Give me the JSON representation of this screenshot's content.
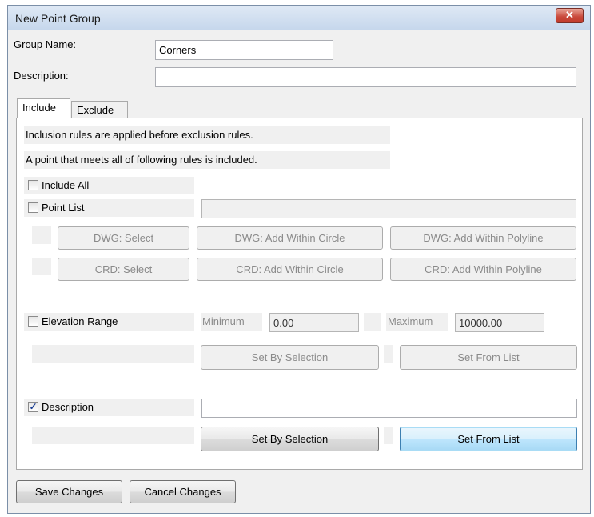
{
  "window": {
    "title": "New Point Group",
    "close_glyph": "✕"
  },
  "form": {
    "group_name_label": "Group Name:",
    "group_name_value": "Corners",
    "description_label": "Description:",
    "description_value": ""
  },
  "tabs": [
    {
      "label": "Include",
      "active": true
    },
    {
      "label": "Exclude",
      "active": false
    }
  ],
  "include": {
    "info_line_1": "Inclusion rules are applied before exclusion rules.",
    "info_line_2": "A point that meets all of following rules is included.",
    "include_all": {
      "label": "Include All",
      "checked": false
    },
    "point_list": {
      "label": "Point List",
      "checked": false,
      "value": ""
    },
    "dwg_buttons": [
      "DWG: Select",
      "DWG: Add Within Circle",
      "DWG: Add Within Polyline"
    ],
    "crd_buttons": [
      "CRD: Select",
      "CRD: Add Within Circle",
      "CRD: Add Within Polyline"
    ],
    "elevation": {
      "label": "Elevation Range",
      "checked": false,
      "min_label": "Minimum",
      "min_value": "0.00",
      "max_label": "Maximum",
      "max_value": "10000.00",
      "set_by_selection": "Set By Selection",
      "set_from_list": "Set From List"
    },
    "description": {
      "label": "Description",
      "checked": true,
      "check_glyph": "✓",
      "value": "",
      "set_by_selection": "Set By Selection",
      "set_from_list": "Set From List"
    }
  },
  "footer": {
    "save": "Save Changes",
    "cancel": "Cancel Changes"
  },
  "colors": {
    "accent": "#3c7fb1",
    "close_red": "#c9483a",
    "disabled_text": "#8a8a8a"
  }
}
